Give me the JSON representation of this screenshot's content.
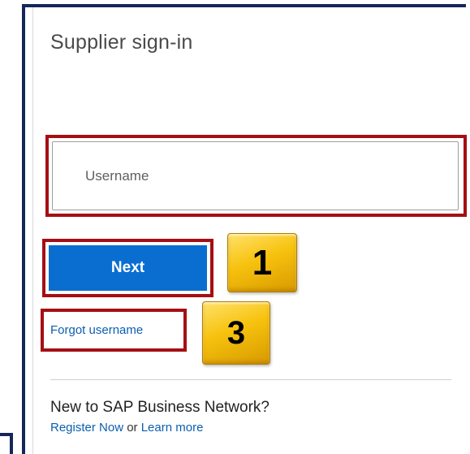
{
  "signin": {
    "title": "Supplier sign-in",
    "username_placeholder": "Username",
    "username_value": "",
    "next_label": "Next",
    "forgot_username_label": "Forgot username"
  },
  "footer": {
    "new_to_network": "New to SAP Business Network?",
    "register_label": "Register Now",
    "or_text": "or",
    "learn_more_label": "Learn more"
  },
  "annotations": {
    "step_1": "1",
    "step_3": "3",
    "highlight_color": "#a40f14",
    "badge_color": "#f7c20e",
    "frame_color": "#14275a",
    "button_color": "#0a6ed1",
    "link_color": "#0a5fb0"
  }
}
